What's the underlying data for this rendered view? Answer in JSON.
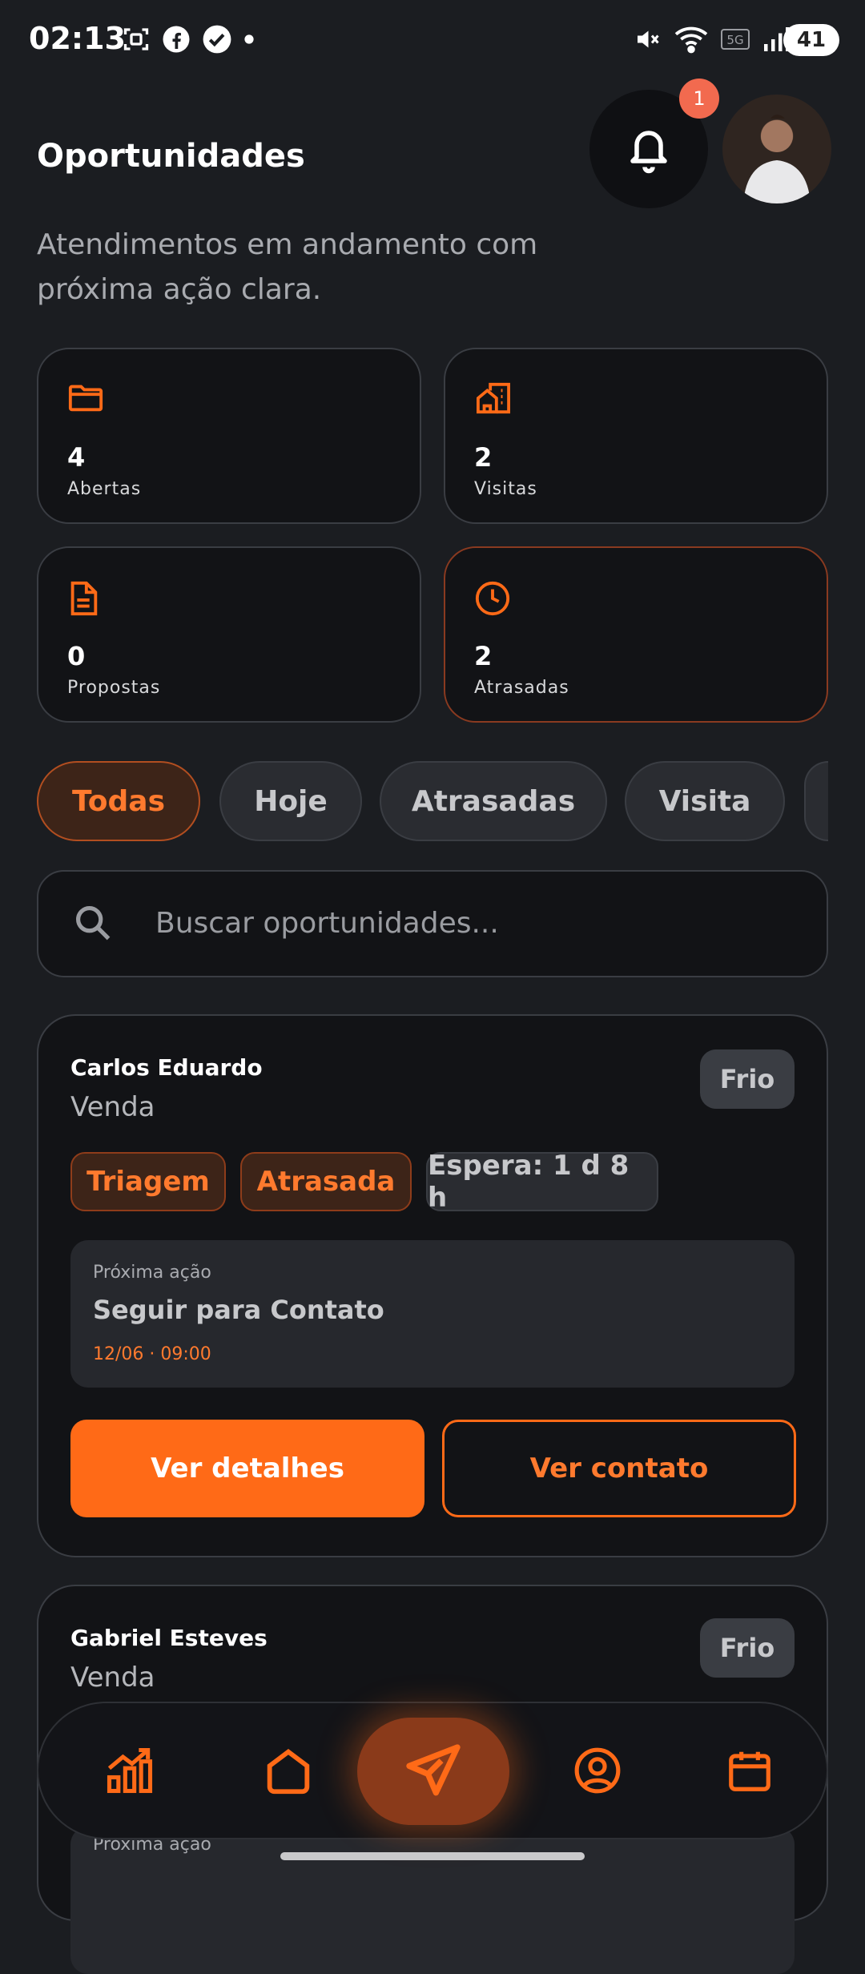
{
  "status_bar": {
    "time": "02:13",
    "battery": "41"
  },
  "header": {
    "title": "Oportunidades",
    "subtitle": "Atendimentos em andamento com próxima ação clara.",
    "notification_count": "1"
  },
  "stats": [
    {
      "value": "4",
      "label": "Abertas",
      "icon": "folder-icon"
    },
    {
      "value": "2",
      "label": "Visitas",
      "icon": "buildings-icon"
    },
    {
      "value": "0",
      "label": "Propostas",
      "icon": "document-icon"
    },
    {
      "value": "2",
      "label": "Atrasadas",
      "icon": "clock-icon"
    }
  ],
  "filters": [
    "Todas",
    "Hoje",
    "Atrasadas",
    "Visita"
  ],
  "active_filter": "Todas",
  "search": {
    "placeholder": "Buscar oportunidades..."
  },
  "opportunities": [
    {
      "name": "Carlos Eduardo",
      "type": "Venda",
      "temperature": "Frio",
      "tags": [
        "Triagem",
        "Atrasada",
        "Espera: 1 d 8 h"
      ],
      "next_label": "Próxima ação",
      "next_action": "Seguir para Contato",
      "next_time": "12/06 · 09:00",
      "primary_button": "Ver detalhes",
      "secondary_button": "Ver contato"
    },
    {
      "name": "Gabriel Esteves",
      "type": "Venda",
      "temperature": "Frio",
      "next_label": "Próxima ação"
    }
  ],
  "colors": {
    "accent": "#ff6a17",
    "background": "#1b1d21",
    "card": "#121316"
  },
  "nav": [
    "chart-icon",
    "home-icon",
    "send-icon",
    "user-circle-icon",
    "calendar-icon"
  ]
}
